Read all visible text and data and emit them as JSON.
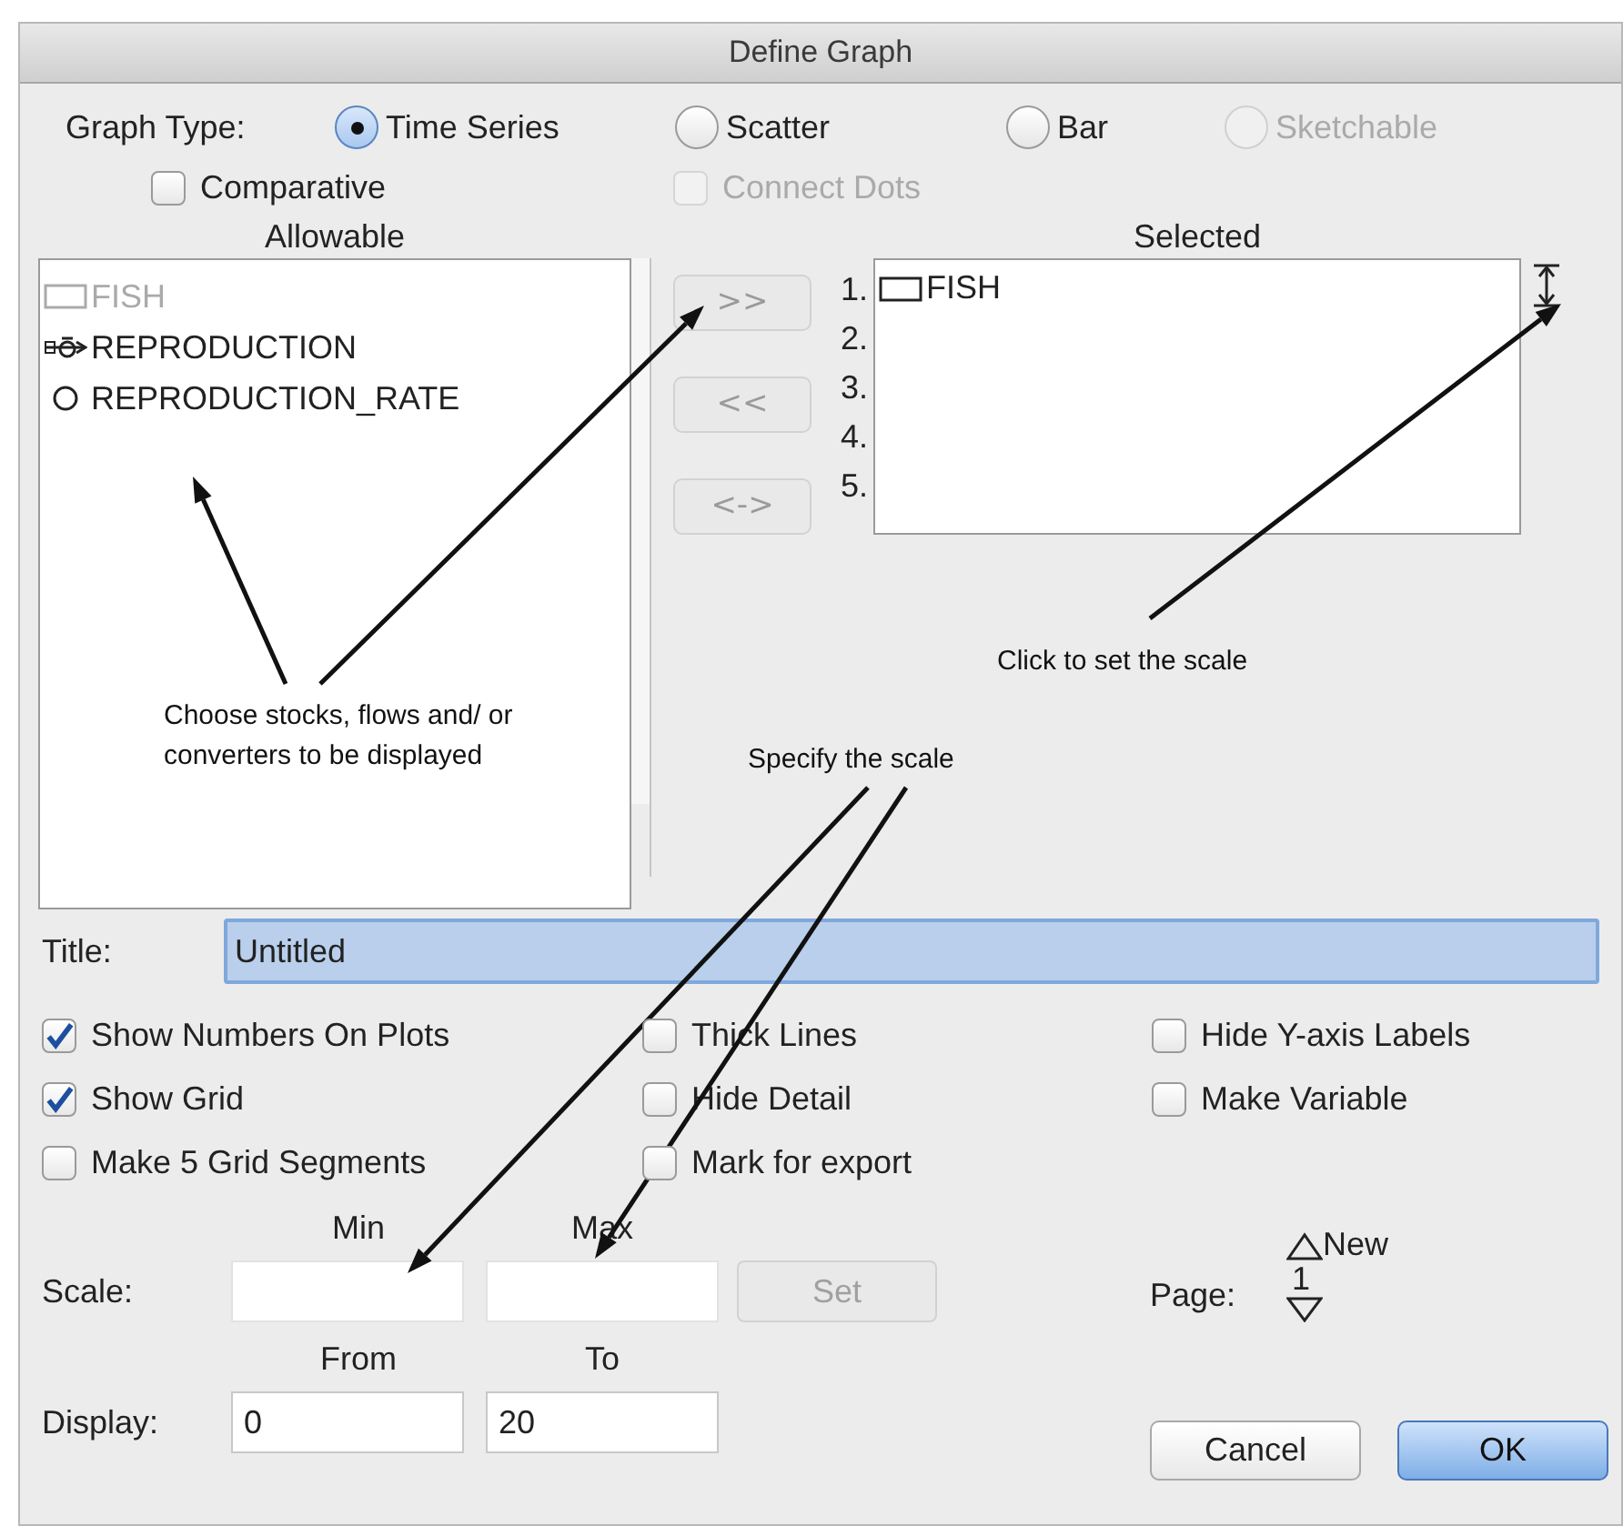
{
  "window": {
    "title": "Define Graph"
  },
  "graph_type": {
    "label": "Graph Type:",
    "options": [
      {
        "label": "Time Series",
        "selected": true,
        "disabled": false
      },
      {
        "label": "Scatter",
        "selected": false,
        "disabled": false
      },
      {
        "label": "Bar",
        "selected": false,
        "disabled": false
      },
      {
        "label": "Sketchable",
        "selected": false,
        "disabled": true
      }
    ]
  },
  "graph_options": [
    {
      "label": "Comparative",
      "checked": false,
      "disabled": false
    },
    {
      "label": "Connect Dots",
      "checked": false,
      "disabled": true
    }
  ],
  "allowable": {
    "heading": "Allowable",
    "items": [
      {
        "kind": "stock",
        "label": "FISH",
        "disabled": true
      },
      {
        "kind": "flow",
        "label": "REPRODUCTION",
        "disabled": false
      },
      {
        "kind": "converter",
        "label": "REPRODUCTION_RATE",
        "disabled": false
      }
    ]
  },
  "move_buttons": [
    ">>",
    "<<",
    "<->"
  ],
  "selected_list": {
    "heading": "Selected",
    "slots": [
      {
        "number": "1.",
        "item": {
          "kind": "stock",
          "label": "FISH"
        }
      },
      {
        "number": "2."
      },
      {
        "number": "3."
      },
      {
        "number": "4."
      },
      {
        "number": "5."
      }
    ]
  },
  "title_field": {
    "label": "Title:",
    "value": "Untitled"
  },
  "checkboxes": [
    {
      "label": "Show Numbers On Plots",
      "checked": true
    },
    {
      "label": "Thick Lines",
      "checked": false
    },
    {
      "label": "Hide Y-axis Labels",
      "checked": false
    },
    {
      "label": "Show Grid",
      "checked": true
    },
    {
      "label": "Hide Detail",
      "checked": false
    },
    {
      "label": "Make Variable",
      "checked": false
    },
    {
      "label": "Make 5 Grid Segments",
      "checked": false
    },
    {
      "label": "Mark for export",
      "checked": false
    }
  ],
  "scale": {
    "label": "Scale:",
    "min_label": "Min",
    "max_label": "Max",
    "set_button": "Set"
  },
  "display": {
    "label": "Display:",
    "from_label": "From",
    "to_label": "To",
    "from": "0",
    "to": "20"
  },
  "page": {
    "label": "Page:",
    "new_label": "New",
    "number": "1"
  },
  "buttons": [
    {
      "label": "Cancel",
      "default": false
    },
    {
      "label": "OK",
      "default": true
    }
  ],
  "annotations": [
    "Choose stocks, flows and/ or converters to be displayed",
    "Click to set the scale",
    "Specify the scale"
  ]
}
